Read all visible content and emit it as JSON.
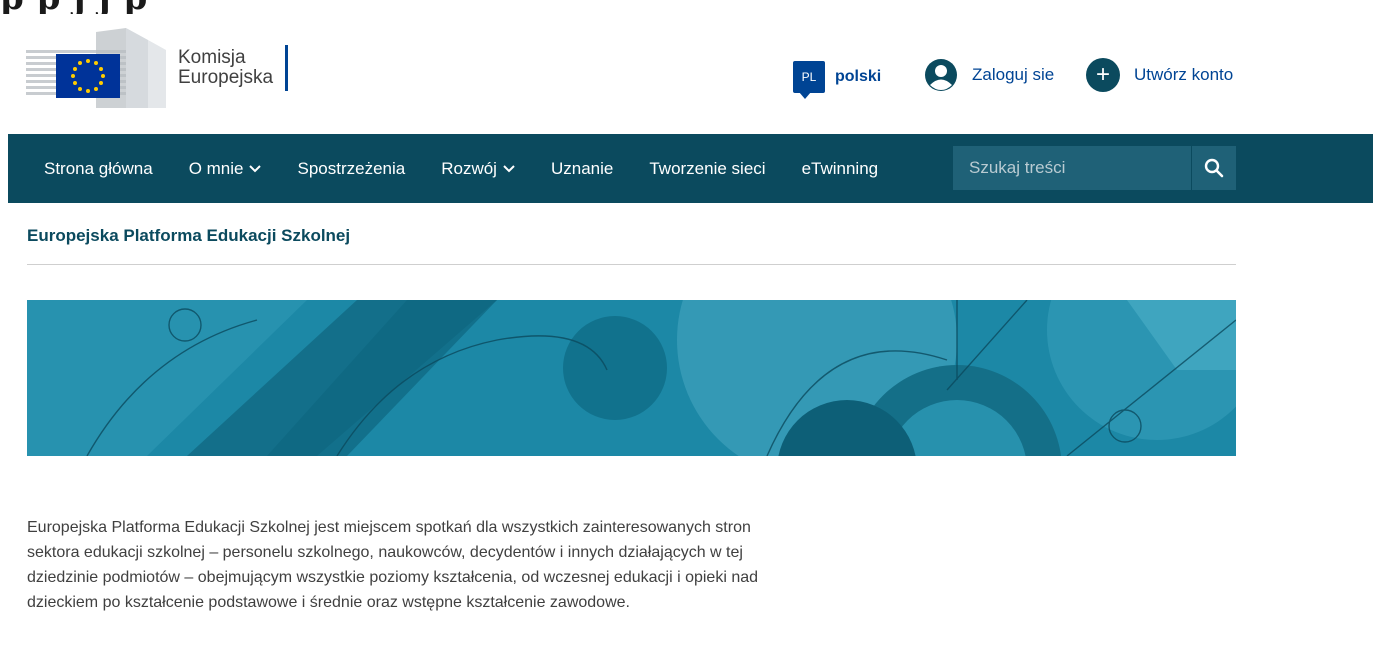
{
  "top_strip": {
    "text": "p                    p  j          j       p"
  },
  "header": {
    "logo_line1": "Komisja",
    "logo_line2": "Europejska",
    "lang_code": "PL",
    "lang_label": "polski",
    "login_label": "Zaloguj sie",
    "create_symbol": "+",
    "create_label": "Utwórz konto"
  },
  "nav": {
    "items": [
      {
        "label": "Strona główna",
        "dropdown": ""
      },
      {
        "label": "O mnie",
        "dropdown": "⌄"
      },
      {
        "label": "Spostrzeżenia",
        "dropdown": ""
      },
      {
        "label": "Rozwój",
        "dropdown": "⌄"
      },
      {
        "label": "Uznanie",
        "dropdown": ""
      },
      {
        "label": "Tworzenie sieci",
        "dropdown": ""
      },
      {
        "label": "eTwinning",
        "dropdown": ""
      }
    ],
    "search_placeholder": "Szukaj treści"
  },
  "site_title": "Europejska Platforma Edukacji Szkolnej",
  "intro_text": "Europejska Platforma Edukacji Szkolnej jest miejscem spotkań dla wszystkich zainteresowanych stron sektora edukacji szkolnej – personelu szkolnego, naukowców, decydentów i innych działających w tej dziedzinie podmiotów – obejmującym wszystkie poziomy kształcenia, od wczesnej edukacji i opieki nad dzieckiem po kształcenie podstawowe i średnie oraz wstępne kształcenie zawodowe.",
  "colors": {
    "nav_bg": "#0b4a5e",
    "accent_blue": "#004494",
    "eu_blue": "#003399",
    "eu_gold": "#ffcc00",
    "banner_base": "#1c88a6"
  },
  "icons": {
    "user": "user-circle-icon",
    "search": "search-icon",
    "create": "plus-circle-icon"
  }
}
